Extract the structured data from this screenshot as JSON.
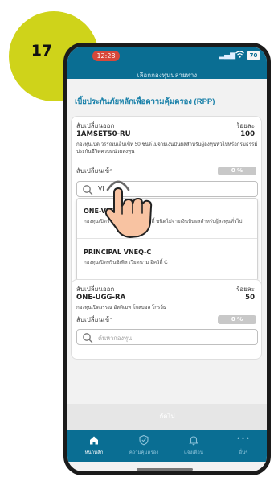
{
  "step_badge": {
    "number": "17",
    "color": "#cfd31a"
  },
  "status_bar": {
    "time": "12:28",
    "battery": "70"
  },
  "header": {
    "title": "เลือกกองทุนปลายทาง"
  },
  "section": {
    "title": "เบี้ยประกันภัยหลักเพื่อความคุ้มครอง (RPP)"
  },
  "cards": [
    {
      "switch_out_label": "สับเปลี่ยนออก",
      "percent_label": "ร้อยละ",
      "fund_code": "1AMSET50-RU",
      "percent_value": "100",
      "description": "กองทุนเปิด วรรณนเอ็นเซ็ท 50 ชนิดไม่จ่ายเงินปันผลสำหรับผู้ลงทุนทั่วไปหรือกรมธรรม์ประกันชีวิตควบหน่วยลงทุน",
      "switch_in_label": "สับเปลี่ยนเข้า",
      "switch_in_percent": "0 %",
      "search_value": "VI",
      "results": [
        {
          "code": "ONE-VIETNAM-RA",
          "description": "กองทุนเปิดวรรณ เวียดนาม อิควิตี้ ชนิดไม่จ่ายเงินปันผลสำหรับผู้ลงทุนทั่วไป"
        },
        {
          "code": "PRINCIPAL VNEQ-C",
          "description": "กองทุนเปิดพรินซิเพิล เวียดนาม อิควิตี้ C"
        }
      ]
    },
    {
      "switch_out_label": "สับเปลี่ยนออก",
      "percent_label": "ร้อยละ",
      "fund_code": "ONE-UGG-RA",
      "percent_value": "50",
      "description": "กองทุนเปิดวรรณ อัลติเมท โกลบอล โกรว์ธ",
      "switch_in_label": "สับเปลี่ยนเข้า",
      "switch_in_percent": "0 %",
      "search_placeholder": "ค้นหากองทุน"
    }
  ],
  "confirm_button": {
    "label": "ถัดไป"
  },
  "tabbar": {
    "tabs": [
      {
        "label": "หน้าหลัก",
        "icon": "home-icon"
      },
      {
        "label": "ความคุ้มครอง",
        "icon": "shield-check-icon"
      },
      {
        "label": "แจ้งเตือน",
        "icon": "bell-icon"
      },
      {
        "label": "อื่นๆ",
        "icon": "more-icon",
        "glyph": "•••"
      }
    ]
  },
  "colors": {
    "header": "#0a6e93",
    "accent": "#167fa8",
    "status_pill": "#d8483a",
    "percent_pill": "#c8c8c8"
  }
}
